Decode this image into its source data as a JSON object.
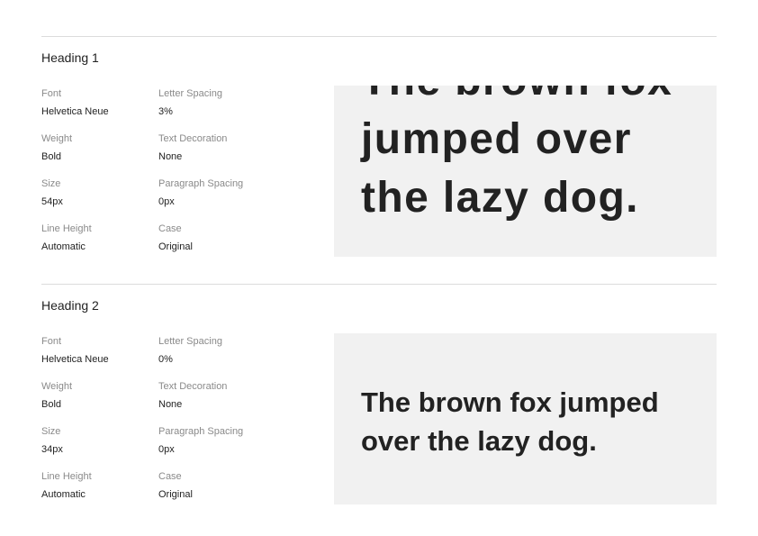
{
  "styles": [
    {
      "title": "Heading 1",
      "props": {
        "font": {
          "label": "Font",
          "value": "Helvetica Neue"
        },
        "letter_spacing": {
          "label": "Letter Spacing",
          "value": "3%"
        },
        "weight": {
          "label": "Weight",
          "value": "Bold"
        },
        "text_decoration": {
          "label": "Text Decoration",
          "value": "None"
        },
        "size": {
          "label": "Size",
          "value": "54px"
        },
        "paragraph_spacing": {
          "label": "Paragraph Spacing",
          "value": "0px"
        },
        "line_height": {
          "label": "Line Height",
          "value": "Automatic"
        },
        "case": {
          "label": "Case",
          "value": "Original"
        }
      },
      "preview_text": "The brown fox jumped over the lazy dog."
    },
    {
      "title": "Heading 2",
      "props": {
        "font": {
          "label": "Font",
          "value": "Helvetica Neue"
        },
        "letter_spacing": {
          "label": "Letter Spacing",
          "value": "0%"
        },
        "weight": {
          "label": "Weight",
          "value": "Bold"
        },
        "text_decoration": {
          "label": "Text Decoration",
          "value": "None"
        },
        "size": {
          "label": "Size",
          "value": "34px"
        },
        "paragraph_spacing": {
          "label": "Paragraph Spacing",
          "value": "0px"
        },
        "line_height": {
          "label": "Line Height",
          "value": "Automatic"
        },
        "case": {
          "label": "Case",
          "value": "Original"
        }
      },
      "preview_text": "The brown fox jumped over the lazy dog."
    }
  ]
}
